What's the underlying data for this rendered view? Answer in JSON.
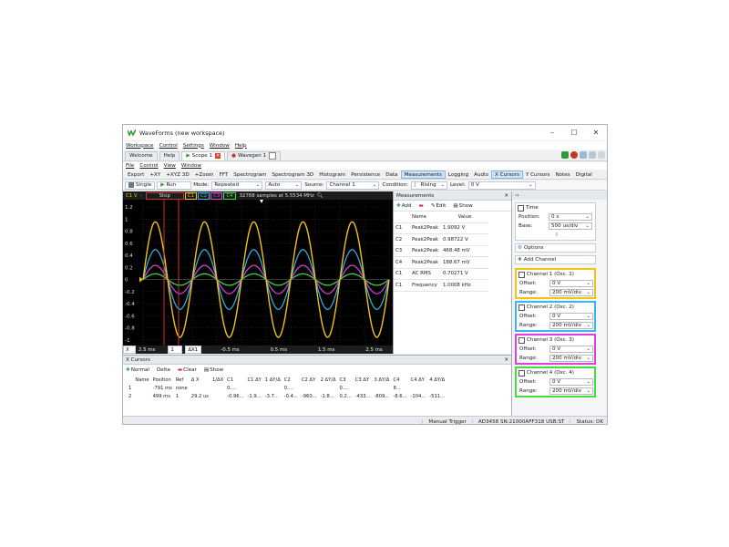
{
  "window": {
    "title": "WaveForms (new workspace)",
    "min": "–",
    "max": "☐",
    "close": "✕"
  },
  "menu": [
    "Workspace",
    "Control",
    "Settings",
    "Window",
    "Help"
  ],
  "tabs": [
    {
      "label": "Welcome"
    },
    {
      "label": "Help"
    },
    {
      "label": "Scope 1"
    },
    {
      "label": "Wavegen 1"
    }
  ],
  "scope_menu": [
    "File",
    "Control",
    "View",
    "Window"
  ],
  "toolbar1": [
    "Export",
    "+XY",
    "+XYZ 3D",
    "+Zoom",
    "FFT",
    "Spectrogram",
    "Spectrogram 3D",
    "Histogram",
    "Persistence",
    "Data",
    "Measurements",
    "Logging",
    "Audio",
    "X Cursors",
    "Y Cursors",
    "Notes",
    "Digital"
  ],
  "toolbar2": {
    "single": "Single",
    "run": "Run",
    "mode_label": "Mode:",
    "mode_value": "Repeated",
    "auto_value": "Auto",
    "source_label": "Source:",
    "source_value": "Channel 1",
    "condition_label": "Condition:",
    "condition_value": "Rising",
    "level_label": "Level:",
    "level_value": "0 V"
  },
  "plot": {
    "top": {
      "c1v": "C1 V",
      "stop": "Stop",
      "c1": "C1",
      "c2": "C2",
      "c3": "C3",
      "c4": "C4",
      "samples": "32768 samples at 5.5534 MHz"
    },
    "y_ticks": [
      "1.2",
      "1",
      "0.8",
      "0.6",
      "0.4",
      "0.2",
      "0",
      "-0.2",
      "-0.4",
      "-0.6",
      "-0.8",
      "-1"
    ],
    "x_ticks": [
      "2.5 ms",
      "-0.5 ms",
      "0.5 ms",
      "1.5 ms",
      "2.5 ms"
    ],
    "bottom_x": "X",
    "bottom_1": "1",
    "bottom_delta": "ΔX1"
  },
  "measurements": {
    "title": "Measurements",
    "toolbar": {
      "add": "Add",
      "edit": "Edit",
      "show": "Show"
    },
    "headers": [
      "",
      "Name",
      "Value"
    ],
    "rows": [
      [
        "C1",
        "Peak2Peak",
        "1.9092 V"
      ],
      [
        "C2",
        "Peak2Peak",
        "0.98722 V"
      ],
      [
        "C3",
        "Peak2Peak",
        "468.48 mV"
      ],
      [
        "C4",
        "Peak2Peak",
        "188.67 mV"
      ],
      [
        "C1",
        "AC RMS",
        "0.70271 V"
      ],
      [
        "C1",
        "Frequency",
        "1.0008 kHz"
      ]
    ]
  },
  "right_panel": {
    "time": {
      "title": "Time",
      "position_label": "Position:",
      "position_value": "0 s",
      "base_label": "Base:",
      "base_value": "500 us/div"
    },
    "options": "Options",
    "add_channel": "Add Channel",
    "channels": [
      {
        "title": "Channel 1 (Osc. 1)",
        "offset_label": "Offset:",
        "offset": "0 V",
        "range_label": "Range:",
        "range": "200 mV/div"
      },
      {
        "title": "Channel 2 (Osc. 2)",
        "offset_label": "Offset:",
        "offset": "0 V",
        "range_label": "Range:",
        "range": "200 mV/div"
      },
      {
        "title": "Channel 3 (Osc. 3)",
        "offset_label": "Offset:",
        "offset": "0 V",
        "range_label": "Range:",
        "range": "200 mV/div"
      },
      {
        "title": "Channel 4 (Osc. 4)",
        "offset_label": "Offset:",
        "offset": "0 V",
        "range_label": "Range:",
        "range": "200 mV/div"
      }
    ]
  },
  "x_cursors": {
    "title": "X Cursors",
    "toolbar": {
      "normal": "Normal",
      "delta": "Delta",
      "clear": "Clear",
      "show": "Show"
    },
    "headers": [
      "",
      "Name",
      "Position",
      "Ref",
      "Δ X",
      "1/ΔX",
      "C1",
      "C1 ΔY",
      "1 ΔY/Δ",
      "C2",
      "C2 ΔY",
      "2 ΔY/Δ",
      "C3",
      "C3 ΔY",
      "3 ΔY/Δ",
      "C4",
      "C4 ΔY",
      "4 ΔY/Δ"
    ],
    "rows": [
      [
        "1",
        "",
        "-791 ms",
        "none",
        "",
        "",
        "0....",
        "",
        "",
        "0....",
        "",
        "",
        "0....",
        "",
        "",
        "8...",
        "",
        ""
      ],
      [
        "2",
        "",
        "499 ms",
        "1",
        "29.2 us",
        "",
        "-0.96...",
        "-1.9...",
        "-3.7...",
        "-0.4...",
        "-960...",
        "-1.8...",
        "0.2...",
        "-433...",
        "-809...",
        "-8.6...",
        "-104...",
        "-511..."
      ]
    ]
  },
  "status": {
    "trigger": "Manual Trigger",
    "device": "AD3458 SN:21000AFF318 USB:ST",
    "state": "Status: OK"
  },
  "colors": {
    "c1": "#f2c40f",
    "c2": "#38b6f0",
    "c3": "#e040e0",
    "c4": "#40e040",
    "accent": "#2a7bd1"
  }
}
